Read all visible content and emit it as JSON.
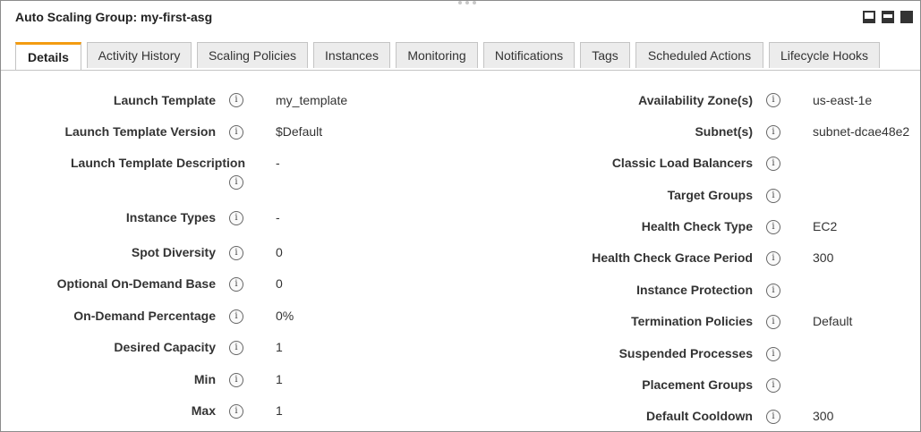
{
  "panel": {
    "title": "Auto Scaling Group: my-first-asg"
  },
  "tabs": [
    {
      "label": "Details",
      "active": true
    },
    {
      "label": "Activity History",
      "active": false
    },
    {
      "label": "Scaling Policies",
      "active": false
    },
    {
      "label": "Instances",
      "active": false
    },
    {
      "label": "Monitoring",
      "active": false
    },
    {
      "label": "Notifications",
      "active": false
    },
    {
      "label": "Tags",
      "active": false
    },
    {
      "label": "Scheduled Actions",
      "active": false
    },
    {
      "label": "Lifecycle Hooks",
      "active": false
    }
  ],
  "left": [
    {
      "label": "Launch Template",
      "value": "my_template"
    },
    {
      "label": "Launch Template Version",
      "value": "$Default"
    },
    {
      "label": "Launch Template Description",
      "value": "-"
    },
    {
      "label": "Instance Types",
      "value": "-"
    },
    {
      "label": "Spot Diversity",
      "value": "0"
    },
    {
      "label": "Optional On-Demand Base",
      "value": "0"
    },
    {
      "label": "On-Demand Percentage",
      "value": "0%"
    },
    {
      "label": "Desired Capacity",
      "value": "1"
    },
    {
      "label": "Min",
      "value": "1"
    },
    {
      "label": "Max",
      "value": "1"
    }
  ],
  "right": [
    {
      "label": "Availability Zone(s)",
      "value": "us-east-1e"
    },
    {
      "label": "Subnet(s)",
      "value": "subnet-dcae48e2"
    },
    {
      "label": "Classic Load Balancers",
      "value": ""
    },
    {
      "label": "Target Groups",
      "value": ""
    },
    {
      "label": "Health Check Type",
      "value": "EC2"
    },
    {
      "label": "Health Check Grace Period",
      "value": "300"
    },
    {
      "label": "Instance Protection",
      "value": ""
    },
    {
      "label": "Termination Policies",
      "value": "Default"
    },
    {
      "label": "Suspended Processes",
      "value": ""
    },
    {
      "label": "Placement Groups",
      "value": ""
    },
    {
      "label": "Default Cooldown",
      "value": "300"
    }
  ],
  "icons": {
    "info": "info-icon",
    "info_glyph": "i"
  }
}
